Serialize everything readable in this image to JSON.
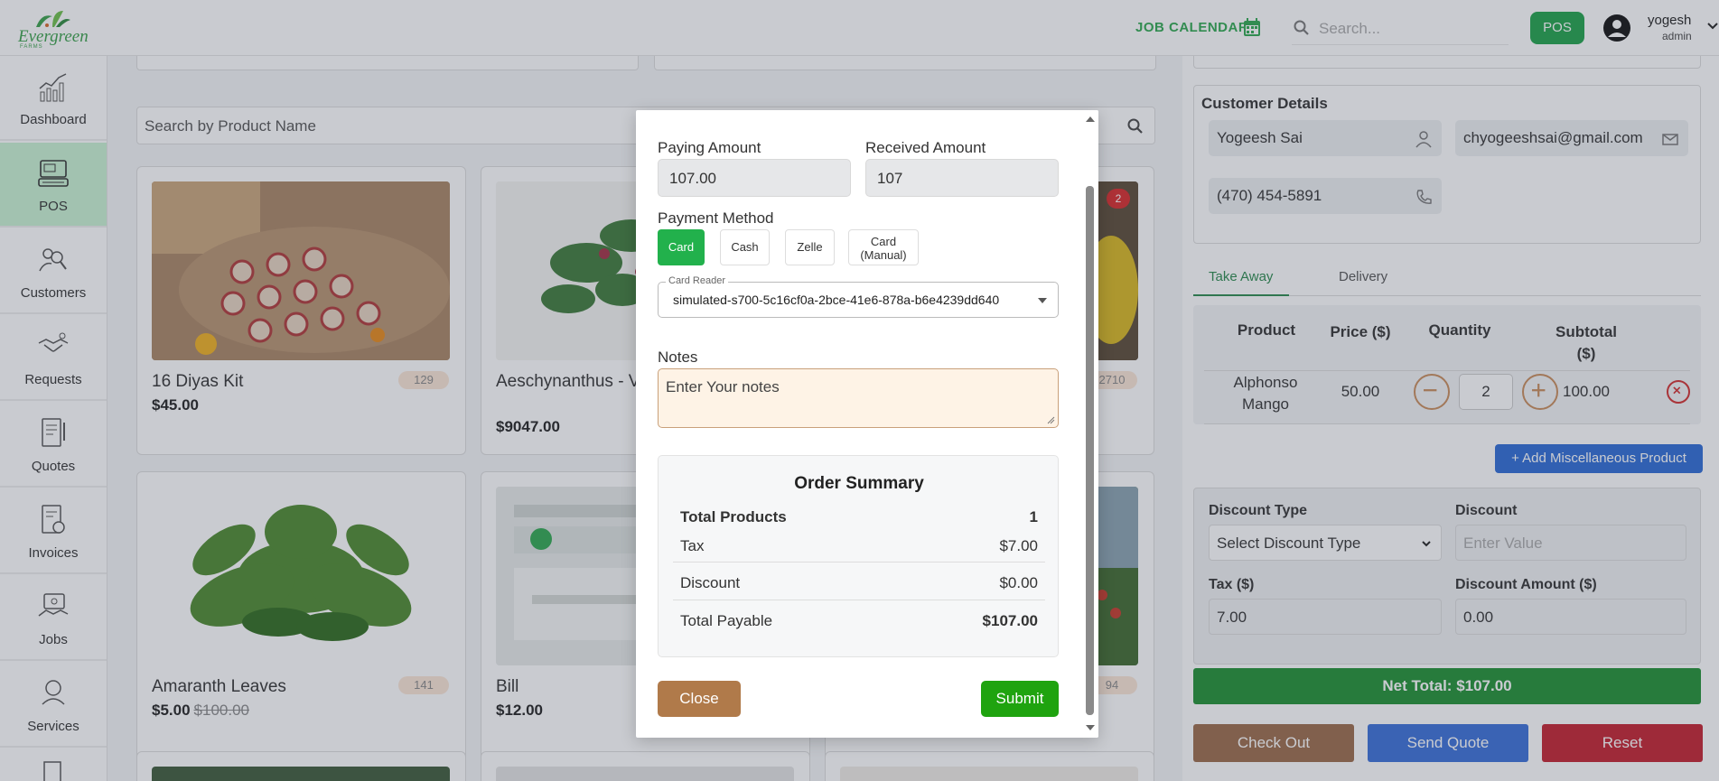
{
  "header": {
    "brand": "Evergreen",
    "brand_sub": "FARMS",
    "job_calendar": "JOB CALENDAR",
    "search_placeholder": "Search...",
    "pos_button": "POS",
    "user_name": "yogesh",
    "user_role": "admin"
  },
  "sidebar": {
    "items": [
      {
        "label": "Dashboard",
        "icon": "chart-icon"
      },
      {
        "label": "POS",
        "icon": "pos-terminal-icon",
        "active": true
      },
      {
        "label": "Customers",
        "icon": "customers-icon"
      },
      {
        "label": "Requests",
        "icon": "handshake-icon"
      },
      {
        "label": "Quotes",
        "icon": "quote-document-icon"
      },
      {
        "label": "Invoices",
        "icon": "invoice-icon"
      },
      {
        "label": "Jobs",
        "icon": "jobs-icon"
      },
      {
        "label": "Services",
        "icon": "services-icon"
      }
    ]
  },
  "main": {
    "product_search_placeholder": "Search by Product Name",
    "products": [
      {
        "name": "16 Diyas Kit",
        "price": "$45.00",
        "old_price": "",
        "stock": "129"
      },
      {
        "name": "Aeschynanthus - Vine",
        "price": "$9047.00",
        "old_price": "",
        "stock": ""
      },
      {
        "name": "",
        "price": "",
        "old_price": "",
        "stock": "2710",
        "badge": "2"
      },
      {
        "name": "Amaranth Leaves",
        "price": "$5.00",
        "old_price": "$100.00",
        "stock": "141"
      },
      {
        "name": "Bill",
        "price": "$12.00",
        "old_price": "",
        "stock": ""
      },
      {
        "name": "",
        "price": "",
        "old_price": "",
        "stock": "94"
      }
    ]
  },
  "right_panel": {
    "customer_title": "Customer Details",
    "customer_name": "Yogeesh Sai",
    "customer_email": "chyogeeshsai@gmail.com",
    "customer_phone": "(470) 454-5891",
    "tabs": [
      "Take Away",
      "Delivery"
    ],
    "cart_headers": {
      "product": "Product",
      "price": "Price ($)",
      "quantity": "Quantity",
      "subtotal": "Subtotal ($)"
    },
    "cart_row": {
      "product": "Alphonso Mango",
      "price": "50.00",
      "quantity": "2",
      "subtotal": "100.00"
    },
    "misc_button": "+ Add Miscellaneous Product",
    "discount_type_label": "Discount Type",
    "discount_type_value": "Select Discount Type",
    "discount_label": "Discount",
    "discount_placeholder": "Enter Value",
    "tax_label": "Tax ($)",
    "tax_value": "7.00",
    "discount_amount_label": "Discount Amount ($)",
    "discount_amount_value": "0.00",
    "net_total": "Net Total: $107.00",
    "checkout": "Check Out",
    "send_quote": "Send Quote",
    "reset": "Reset"
  },
  "modal": {
    "paying_amount_label": "Paying Amount",
    "paying_amount_value": "107.00",
    "received_amount_label": "Received Amount",
    "received_amount_value": "107",
    "payment_method_label": "Payment Method",
    "payment_methods": [
      "Card",
      "Cash",
      "Zelle",
      "Card (Manual)"
    ],
    "card_reader_label": "Card Reader",
    "card_reader_value": "simulated-s700-5c16cf0a-2bce-41e6-878a-b6e4239dd640",
    "notes_label": "Notes",
    "notes_placeholder": "Enter Your notes",
    "summary_title": "Order Summary",
    "summary": [
      {
        "label": "Total Products",
        "value": "1"
      },
      {
        "label": "Tax",
        "value": "$7.00"
      },
      {
        "label": "Discount",
        "value": "$0.00"
      },
      {
        "label": "Total Payable",
        "value": "$107.00"
      }
    ],
    "close": "Close",
    "submit": "Submit"
  },
  "colors": {
    "brand_green": "#2fa84f",
    "active_side": "#c9f3d3",
    "submit_green": "#1fa30f",
    "close_brown": "#b07a4a",
    "net_total_green": "#1f9133",
    "checkout_brown": "#9b6b4a",
    "send_quote_blue": "#3a6fd8",
    "reset_red": "#c4202e"
  }
}
